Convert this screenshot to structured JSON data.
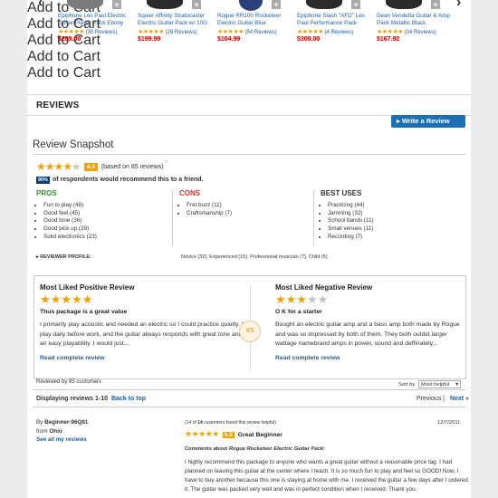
{
  "carousel": {
    "products": [
      {
        "name": "Epiphone Les Paul Electric Guitar Player Pack Ebony",
        "stars": "★★★★★",
        "reviews": "(30 Reviews)",
        "price": "$209.00",
        "cart": "Add to Cart"
      },
      {
        "name": "Squier Affinity Stratocaster Electric Guitar Pack w/ 10G",
        "stars": "★★★★★",
        "reviews": "(28 Reviews)",
        "price": "$199.99",
        "cart": "Add to Cart"
      },
      {
        "name": "Rogue RR100 Rocketeer Electric Guitar Blue",
        "stars": "★★★★★",
        "reviews": "(54 Reviews)",
        "price": "$104.99",
        "cart": "Add to Cart"
      },
      {
        "name": "Epiphone Slash \"AFD\" Les Paul Performance Pack",
        "stars": "★★★★★",
        "reviews": "(4 Reviews)",
        "price": "$309.00",
        "cart": "Add to Cart"
      },
      {
        "name": "Dean Vendetta Guitar & Amp Pack Metallic Black",
        "stars": "★★★★★",
        "reviews": "(34 Reviews)",
        "price": "$167.92",
        "cart": "Add to Cart"
      }
    ],
    "compare_glyph": "+",
    "prev_glyph": "‹",
    "next_glyph": "›"
  },
  "reviews": {
    "heading": "REVIEWS",
    "write_button": "Write a Review",
    "write_icon": "▸"
  },
  "snapshot": {
    "title": "Review Snapshot",
    "stars_full": "★★★★",
    "stars_empty": "★",
    "score": "4.3",
    "based_on": "(based on 85 reviews)",
    "rss_glyph": "ᵊ",
    "recommend_pct": "90%",
    "recommend_text": "of respondents would recommend this to a friend.",
    "pros": {
      "title": "PROS",
      "items": [
        "Fun to play (48)",
        "Good feel (45)",
        "Good tone (36)",
        "Good pick up (29)",
        "Solid electronics (23)"
      ]
    },
    "cons": {
      "title": "CONS",
      "items": [
        "Fret buzz (11)",
        "Craftsmanship (7)"
      ]
    },
    "uses": {
      "title": "BEST USES",
      "items": [
        "Practicing (44)",
        "Jamming (32)",
        "School bands (11)",
        "Small venues (11)",
        "Recording (7)"
      ]
    },
    "profile_label": "▸ REVIEWER PROFILE:",
    "profile_value": "Novice (32), Experienced (15), Professional musician (7), Child (6)"
  },
  "most_liked": {
    "positive": {
      "heading": "Most Liked Positive Review",
      "stars_full": "★★★★★",
      "stars_empty": "",
      "title": "Thus package is a great value",
      "body": "I primarily play acoustic and needed an electric so I could practice quietly. I play daily before work, and the guitar always responds with great tone and an easy playability. I would just...",
      "read": "Read complete review"
    },
    "negative": {
      "heading": "Most Liked Negative Review",
      "stars_full": "★★★",
      "stars_empty": "★★",
      "title": "O K for a starter",
      "body": "Bought an electric guitar amp and a bass amp both made by Rogue and was so impressed by both of them. They both outdid larger wattage namebrand amps in power, sound and deffinately...",
      "read": "Read complete review"
    },
    "vs": "VS"
  },
  "listing": {
    "reviewed_by": "Reviewed by 85 customers",
    "sort_label": "Sort by",
    "sort_value": "Most helpful",
    "displaying": "Displaying reviews 1-10",
    "back_to_top": "Back to top",
    "previous": "Previous |",
    "next": "Next »"
  },
  "review1": {
    "by_label": "By",
    "reviewer": "Beginner-96Q81",
    "from_label": "from",
    "location": "Ohio",
    "all_reviews": "See all my reviews",
    "helpful_prefix": "(14 of",
    "helpful_count": "14",
    "helpful_suffix": "customers found this review helpful)",
    "date": "12/7/2011",
    "stars": "★★★★★",
    "score": "5.0",
    "title": "Great Beginner",
    "comments_label": "Comments about",
    "product": "Rogue Rocketeer Electric Guitar Pack:",
    "body": "I highly recommend this package to anyone who wants a great guitar without a reasonable price tag. I had planned on leaving this guitar at the center where I teach. It is so much fun to play and feel so GOOD! Now, I have to buy another because this one is staying at home with me. I received the guitar a few days after I ordered it. The guitar was packed very well and was in perfect condition when I received. Thank you."
  },
  "colors": {
    "accent": "#1d6fb4",
    "star": "#f2a100",
    "price": "#cc0000",
    "pros": "#3a8a3a",
    "cons": "#c0392b"
  }
}
